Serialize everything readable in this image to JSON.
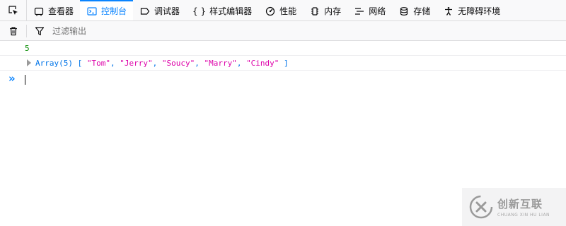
{
  "toolbar": {
    "tabs": [
      {
        "label": "查看器",
        "icon": "inspector-icon",
        "active": false
      },
      {
        "label": "控制台",
        "icon": "console-icon",
        "active": true
      },
      {
        "label": "调试器",
        "icon": "debugger-icon",
        "active": false
      },
      {
        "label": "样式编辑器",
        "icon": "style-editor-icon",
        "active": false
      },
      {
        "label": "性能",
        "icon": "performance-icon",
        "active": false
      },
      {
        "label": "内存",
        "icon": "memory-icon",
        "active": false
      },
      {
        "label": "网络",
        "icon": "network-icon",
        "active": false
      },
      {
        "label": "存储",
        "icon": "storage-icon",
        "active": false
      },
      {
        "label": "无障碍环境",
        "icon": "accessibility-icon",
        "active": false
      }
    ],
    "style_editor_glyph": "{ }"
  },
  "filterbar": {
    "placeholder": "过滤输出"
  },
  "console": {
    "messages": [
      {
        "type": "number",
        "text": "5"
      },
      {
        "type": "array",
        "prefix": "Array(5)",
        "open": "[",
        "items": [
          "\"Tom\"",
          "\"Jerry\"",
          "\"Soucy\"",
          "\"Marry\"",
          "\"Cindy\""
        ],
        "separator": ", ",
        "close": "]"
      }
    ],
    "prompt": "»"
  },
  "watermark": {
    "brand_cn": "创新互联",
    "brand_en": "CHUANG XIN HU LIAN"
  },
  "colors": {
    "accent": "#0a84ff",
    "number": "#058b00",
    "string": "#dd00a9",
    "object": "#0074e8"
  }
}
